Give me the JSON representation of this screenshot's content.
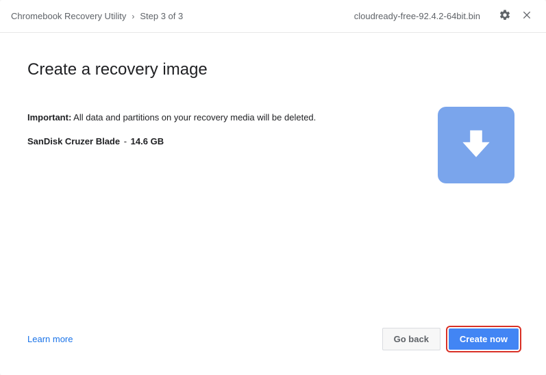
{
  "titlebar": {
    "app_title": "Chromebook Recovery Utility",
    "chevron": "›",
    "step": "Step 3 of 3",
    "filename": "cloudready-free-92.4.2-64bit.bin"
  },
  "main": {
    "page_title": "Create a recovery image",
    "important_label": "Important:",
    "important_text": " All data and partitions on your recovery media will be deleted.",
    "device_name": "SanDisk Cruzer Blade",
    "device_dash": " - ",
    "device_size": "14.6 GB"
  },
  "footer": {
    "learn_more": "Learn more",
    "go_back": "Go back",
    "create_now": "Create now"
  }
}
